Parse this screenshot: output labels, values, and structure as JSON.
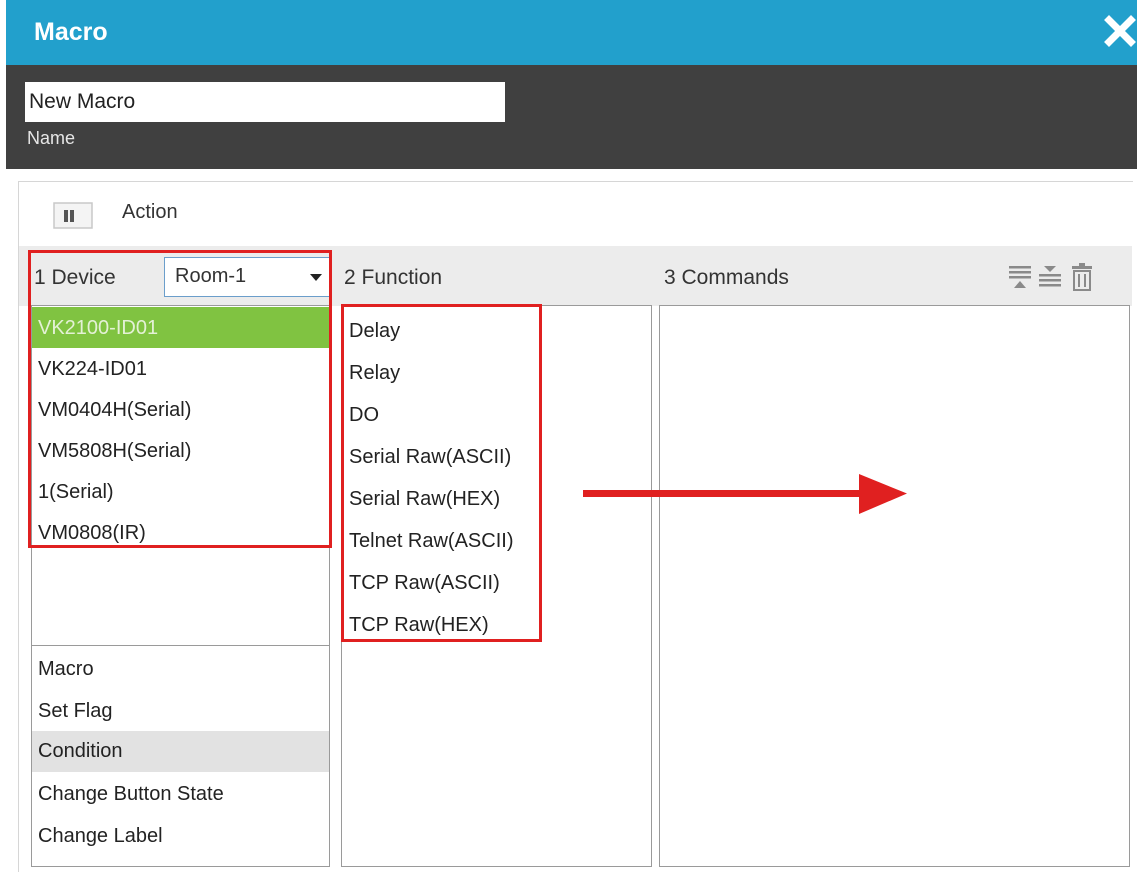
{
  "window": {
    "title": "Macro"
  },
  "name_field": {
    "value": "New Macro",
    "label": "Name"
  },
  "action": {
    "label": "Action"
  },
  "columns": {
    "device": {
      "header": "1  Device",
      "selected_room": "Room-1"
    },
    "function": {
      "header": "2  Function"
    },
    "commands": {
      "header": "3  Commands"
    }
  },
  "devices": [
    "VK2100-ID01",
    "VK224-ID01",
    "VM0404H(Serial)",
    "VM5808H(Serial)",
    "1(Serial)",
    "VM0808(IR)"
  ],
  "selected_device": "VK2100-ID01",
  "actions": [
    "Macro",
    "Set Flag",
    "Condition",
    "Change Button State",
    "Change Label"
  ],
  "selected_action": "Condition",
  "functions": [
    "Delay",
    "Relay",
    "DO",
    "Serial Raw(ASCII)",
    "Serial Raw(HEX)",
    "Telnet Raw(ASCII)",
    "TCP Raw(ASCII)",
    "TCP Raw(HEX)"
  ],
  "icons": {
    "close": "close-icon",
    "action_toggle": "panel-toggle-icon",
    "dropdown": "chevron-down-icon",
    "command_tools": [
      "insert-command-icon",
      "add-command-icon",
      "trash-icon"
    ]
  },
  "colors": {
    "titlebar": "#22a0cc",
    "namebar": "#404040",
    "selected_device": "#80c341",
    "selected_action": "#e2e2e2",
    "annotation": "#e02020"
  }
}
